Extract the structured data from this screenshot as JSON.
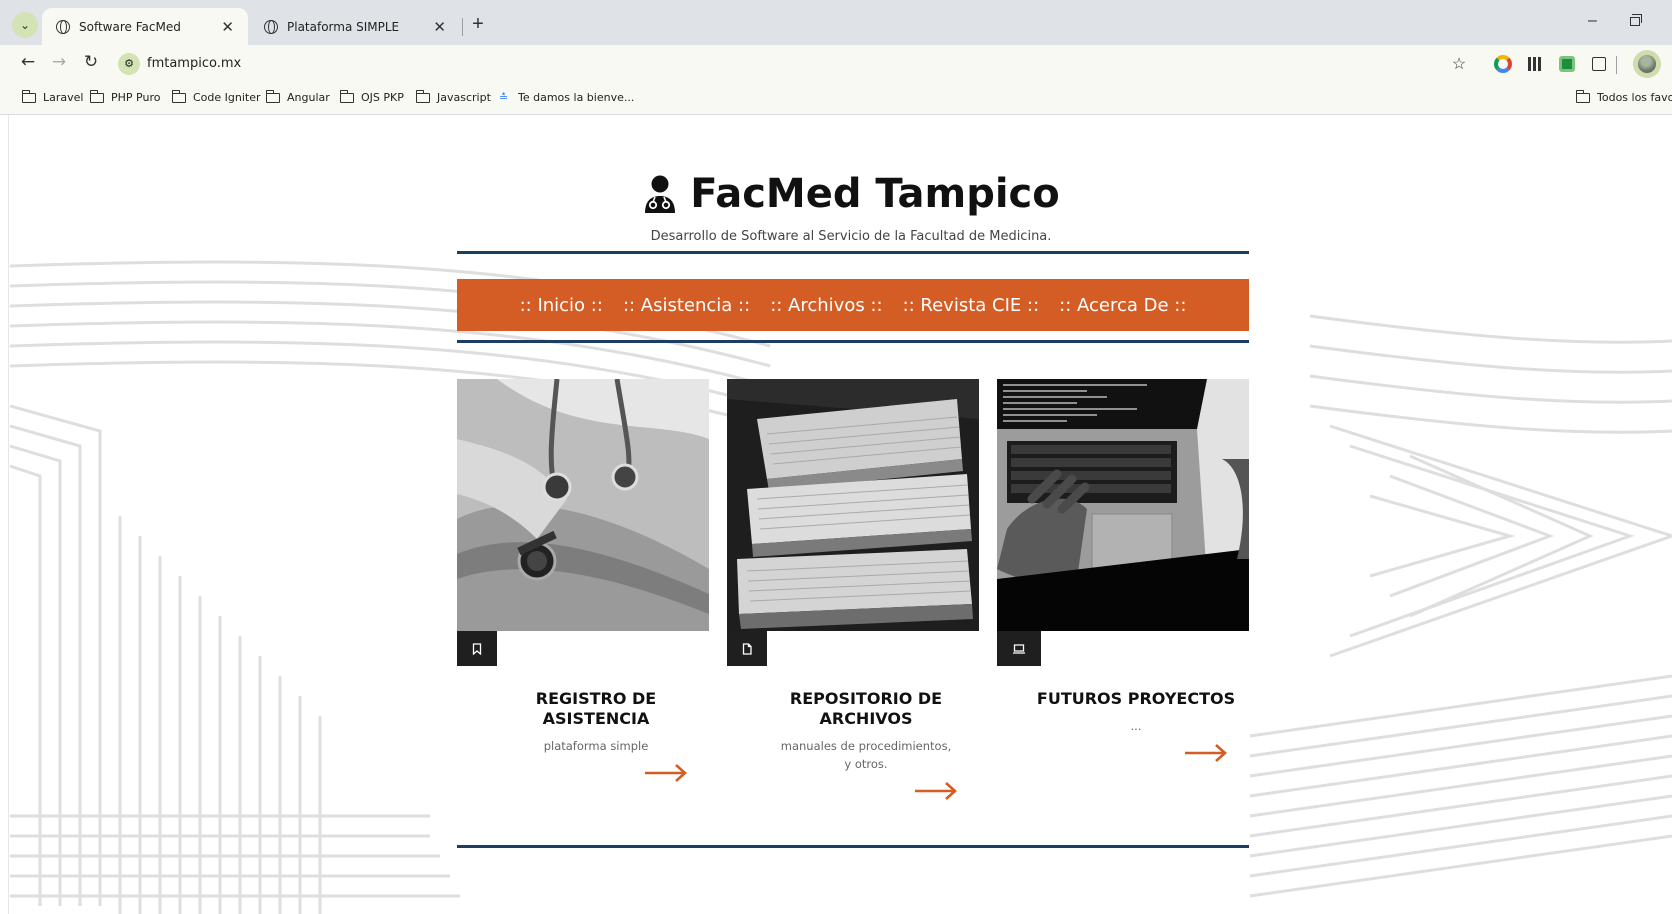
{
  "browser": {
    "tabs": [
      {
        "title": "Software FacMed",
        "active": true
      },
      {
        "title": "Plataforma SIMPLE",
        "active": false
      }
    ],
    "url": "fmtampico.mx",
    "bookmarks": [
      "Laravel",
      "PHP Puro",
      "Code Igniter",
      "Angular",
      "OJS PKP",
      "Javascript",
      "Te damos la bienve..."
    ],
    "all_bookmarks_label": "Todos los favori",
    "icons": {
      "tab_menu": "chevron-down-icon",
      "close": "close-icon",
      "new_tab": "plus-icon",
      "back": "back-arrow-icon",
      "forward": "forward-arrow-icon",
      "reload": "reload-icon",
      "star": "star-icon",
      "extensions": "puzzle-icon"
    }
  },
  "site": {
    "title": "FacMed Tampico",
    "subtitle": "Desarrollo de Software al Servicio de la Facultad de Medicina.",
    "menu": [
      ":: Inicio ::",
      ":: Asistencia ::",
      ":: Archivos ::",
      ":: Revista CIE ::",
      ":: Acerca De ::"
    ],
    "colors": {
      "menu_bg": "#d45d26",
      "rule": "#1d3e63",
      "arrow": "#d45d26",
      "badge": "#1f1f1f"
    },
    "cards": [
      {
        "title": "REGISTRO DE ASISTENCIA",
        "description": "plataforma simple",
        "icon": "bookmark-icon",
        "image": "doctor-stethoscope-photo"
      },
      {
        "title": "REPOSITORIO DE ARCHIVOS",
        "description": "manuales de procedimientos, y otros.",
        "icon": "document-icon",
        "image": "folders-stack-photo"
      },
      {
        "title": "FUTUROS PROYECTOS",
        "description": "...",
        "icon": "laptop-icon",
        "image": "laptop-typing-photo"
      }
    ]
  }
}
